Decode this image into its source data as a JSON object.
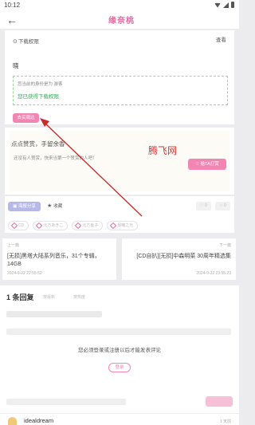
{
  "status_bar": {
    "time": "10:12"
  },
  "header": {
    "logo_text": "缘奈桃"
  },
  "download": {
    "title": "下载权限",
    "view_label": "查看",
    "greeting": "晓",
    "identity_line": "您当前的身份是为 游客",
    "permission_line": "您已获得下载权限",
    "shop_button": "去买周边"
  },
  "reward": {
    "title": "点点赞赏，手留余香",
    "subtitle": "还没有人赞赏，快来当第一个赞赏的人吧！",
    "watermark": "腾飞网",
    "button": "给TA打赏"
  },
  "actions": {
    "share": "海报分享",
    "favorite": "收藏",
    "like_count": "0",
    "dislike_count": "0"
  },
  "tags": [
    "CD",
    "北方あきこ",
    "北方鱼子",
    "晨曦之光"
  ],
  "prev_post": {
    "label": "上一篇",
    "title": "[无损]黑塔大陆系列音乐，31个专辑，14GB",
    "date": "2024-9-22 22:55:52"
  },
  "next_post": {
    "label": "下一篇",
    "title": "[CD自扒][无损]中森明菜 30周年精选集",
    "date": "2024-9-22 23:55:23"
  },
  "comments": {
    "title": "1 条回复",
    "filter_latest": "按最新",
    "filter_hot": "按热度",
    "login_prompt": "您必须登录或注册以后才能发表评论",
    "login_button": "登录",
    "first_user": "idealdream",
    "first_time": "1 天前"
  },
  "colors": {
    "accent_pink": "#f286b3",
    "success_green": "#3aa55b",
    "watermark_red": "#d93838"
  }
}
